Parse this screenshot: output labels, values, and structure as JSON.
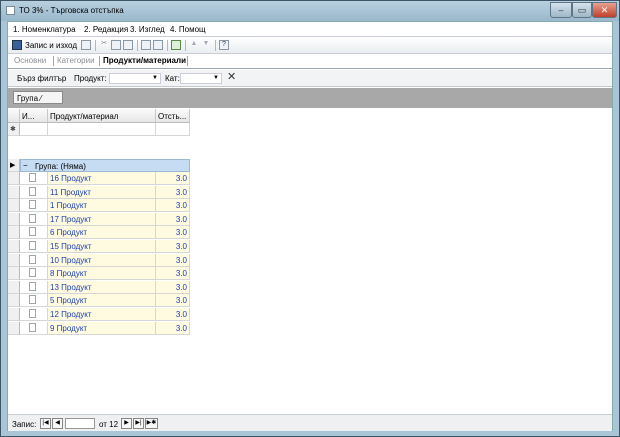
{
  "window": {
    "title": "ТО 3% - Търговска отстъпка",
    "min_glyph": "–",
    "max_glyph": "▭",
    "close_glyph": "✕"
  },
  "menu": {
    "items": [
      "1. Номенклатура",
      "2. Редакция",
      "3. Изглед",
      "4. Помощ"
    ]
  },
  "toolbar": {
    "save_label": "Запис и изход",
    "help_glyph": "?"
  },
  "tabs": [
    {
      "label": "Основни",
      "active": false
    },
    {
      "label": "Категории",
      "active": false
    },
    {
      "label": "Продукти/материали",
      "active": true
    }
  ],
  "filter": {
    "quick_label": "Бърз филтър",
    "product_label": "Продукт:",
    "cat_label": "Кат:",
    "clear_glyph": "✕"
  },
  "group_chip": "Група ⁄",
  "grid": {
    "columns": [
      "И...",
      "Продукт/материал",
      "Отсть..."
    ],
    "new_row_marker": "✱",
    "current_marker": "▶",
    "group_collapse": "−",
    "group_label": "Група: (Няма)",
    "rows": [
      {
        "name": "16 Продукт",
        "value": "3.0"
      },
      {
        "name": "11 Продукт",
        "value": "3.0"
      },
      {
        "name": "1 Продукт",
        "value": "3.0"
      },
      {
        "name": "17 Продукт",
        "value": "3.0"
      },
      {
        "name": "6 Продукт",
        "value": "3.0"
      },
      {
        "name": "15 Продукт",
        "value": "3.0"
      },
      {
        "name": "10 Продукт",
        "value": "3.0"
      },
      {
        "name": "8 Продукт",
        "value": "3.0"
      },
      {
        "name": "13 Продукт",
        "value": "3.0"
      },
      {
        "name": "5 Продукт",
        "value": "3.0"
      },
      {
        "name": "12 Продукт",
        "value": "3.0"
      },
      {
        "name": "9 Продукт",
        "value": "3.0"
      }
    ]
  },
  "status": {
    "record_label": "Запис:",
    "of_label": "от 12",
    "first_glyph": "|◀",
    "prev_glyph": "◀",
    "next_glyph": "▶",
    "last_glyph": "▶|",
    "new_glyph": "▶✱"
  },
  "colors": {
    "accent": "#1b3fb8",
    "group_row": "#c6dcf2",
    "row_bg": "#fffbe0"
  }
}
